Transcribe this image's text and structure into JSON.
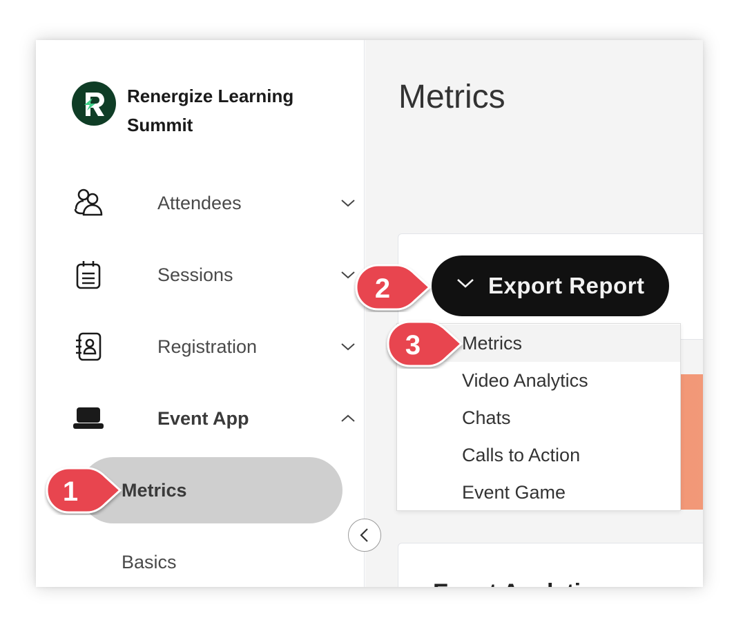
{
  "brand": {
    "name": "Renergize Learning Summit"
  },
  "sidebar": {
    "items": [
      {
        "label": "Attendees",
        "icon": "attendees-icon",
        "expanded": false
      },
      {
        "label": "Sessions",
        "icon": "sessions-icon",
        "expanded": false
      },
      {
        "label": "Registration",
        "icon": "registration-icon",
        "expanded": false
      },
      {
        "label": "Event App",
        "icon": "event-app-icon",
        "expanded": true
      }
    ],
    "subitems": [
      {
        "label": "Metrics",
        "active": true
      },
      {
        "label": "Basics",
        "active": false
      }
    ]
  },
  "main": {
    "title": "Metrics",
    "card2_title": "Event Analytics",
    "export_button": {
      "label": "Export Report"
    },
    "export_menu": [
      {
        "label": "Metrics",
        "hover": true
      },
      {
        "label": "Video Analytics"
      },
      {
        "label": "Chats"
      },
      {
        "label": "Calls to Action"
      },
      {
        "label": "Event Game"
      }
    ]
  },
  "annotations": [
    {
      "number": "1"
    },
    {
      "number": "2"
    },
    {
      "number": "3"
    }
  ],
  "colors": {
    "logo_bg": "#0f3d26",
    "logo_accent": "#3fd18a",
    "active_bg": "#cfcfcf",
    "export_button_bg": "#111111",
    "callout_red": "#e8454f",
    "banner": "#ee8070"
  }
}
